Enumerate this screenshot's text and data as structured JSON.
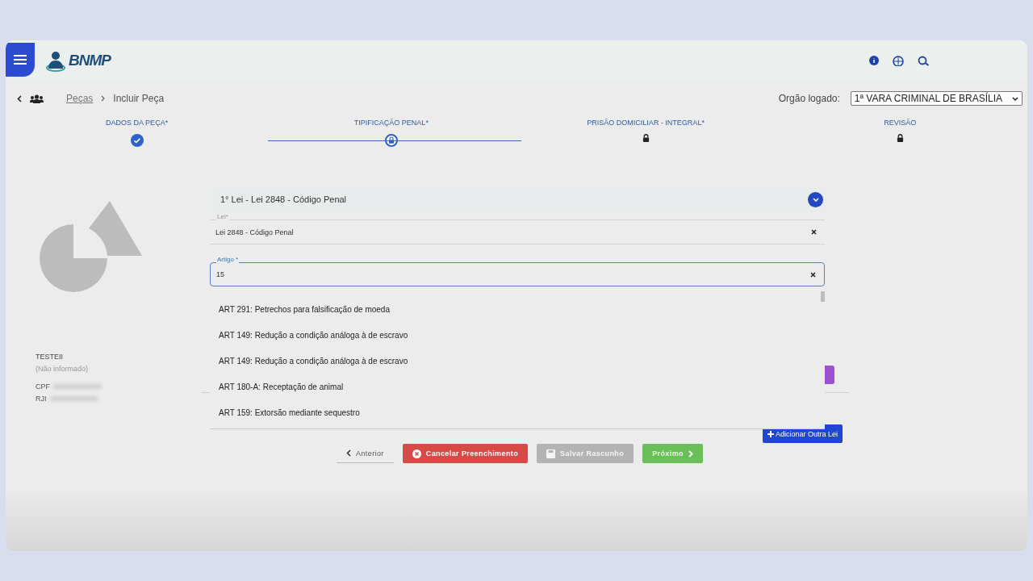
{
  "header": {
    "logo": "BNMP"
  },
  "breadcrumb": [
    {
      "label": "Peças",
      "kind": "link"
    },
    {
      "label": "Incluir Peça",
      "kind": "current"
    }
  ],
  "org": {
    "label": "Orgão logado:",
    "value": "1ª VARA CRIMINAL DE BRASÍLIA"
  },
  "steps": [
    {
      "label": "DADOS DA PEÇA*",
      "completed": true,
      "selected": false
    },
    {
      "label": "TIPIFICAÇÃO PENAL*",
      "completed": false,
      "selected": true
    },
    {
      "label": "PRISÃO DOMICILIAR - INTEGRAL*",
      "completed": false,
      "selected": false
    },
    {
      "label": "REVISÃO",
      "completed": false,
      "selected": false
    }
  ],
  "profile": {
    "name": "TESTEII",
    "note": "(Não informado)",
    "fields": [
      {
        "label": "CPF"
      },
      {
        "label": "RJI"
      }
    ]
  },
  "lei_panel": {
    "title": "1° Lei - Lei 2848 - Código Penal",
    "expanded": true
  },
  "lei_field": {
    "label": "Lei*",
    "value": "Lei 2848 - Código Penal"
  },
  "artigo_field": {
    "label": "Artigo *",
    "value": "15",
    "focused": true
  },
  "options": [
    {
      "label": "ART 291: Petrechos para falsificação de moeda"
    },
    {
      "label": "ART 149: Redução a condição análoga à de escravo"
    },
    {
      "label": "ART 149: Redução a condição análoga à de escravo"
    },
    {
      "label": "ART 180-A: Receptação de animal"
    },
    {
      "label": "ART 159: Extorsão mediante sequestro"
    }
  ],
  "add_button": {
    "label": "Adicionar Outra Lei"
  },
  "buttons": [
    {
      "label": "Anterior",
      "kind": "back",
      "disabled": false
    },
    {
      "label": "Cancelar Preenchimento",
      "kind": "danger",
      "disabled": false
    },
    {
      "label": "Salvar Rascunho",
      "kind": "save",
      "disabled": true
    },
    {
      "label": "Próximo",
      "kind": "next",
      "disabled": false
    }
  ]
}
